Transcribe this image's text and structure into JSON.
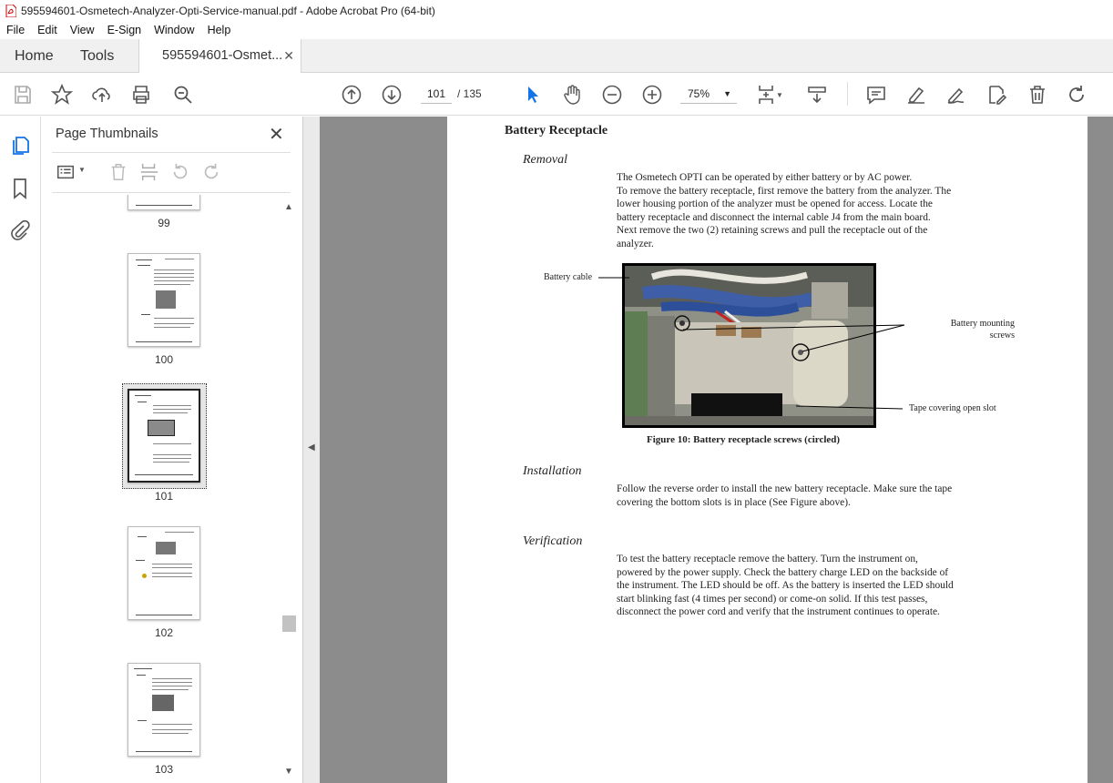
{
  "window": {
    "title": "595594601-Osmetech-Analyzer-Opti-Service-manual.pdf - Adobe Acrobat Pro (64-bit)"
  },
  "menu": [
    "File",
    "Edit",
    "View",
    "E-Sign",
    "Window",
    "Help"
  ],
  "tabs": {
    "home": "Home",
    "tools": "Tools",
    "doc": "595594601-Osmet...",
    "close": "✕"
  },
  "toolbar": {
    "page_current": "101",
    "page_total": "/ 135",
    "zoom": "75%"
  },
  "panel": {
    "title": "Page Thumbnails",
    "close": "✕"
  },
  "thumbnails": [
    {
      "label": "99"
    },
    {
      "label": "100"
    },
    {
      "label": "101",
      "selected": true
    },
    {
      "label": "102"
    },
    {
      "label": "103"
    }
  ],
  "doc": {
    "heading": "Battery Receptacle",
    "removal_title": "Removal",
    "removal_lines": [
      "The Osmetech OPTI can be operated by either battery or by AC power.",
      "To remove the battery receptacle, first remove the battery from the analyzer.  The",
      "lower housing portion of the analyzer must be opened for access.  Locate the",
      "battery receptacle and disconnect the internal cable J4 from the main board.",
      "Next remove the two (2) retaining screws and pull the receptacle out of the",
      "analyzer."
    ],
    "figure": {
      "label_cable": "Battery cable",
      "label_screws_1": "Battery mounting",
      "label_screws_2": "screws",
      "label_tape": "Tape covering open slot",
      "caption": "Figure 10: Battery receptacle screws (circled)"
    },
    "installation_title": "Installation",
    "installation_lines": [
      "Follow the reverse order to install the new battery receptacle. Make sure the tape",
      "covering the bottom slots is in place (See Figure above)."
    ],
    "verification_title": "Verification",
    "verification_lines": [
      "To test the battery receptacle remove the battery. Turn the instrument on,",
      "powered by the power supply. Check the battery charge LED on the backside of",
      "the instrument. The LED should be off. As the battery is inserted the LED should",
      "start blinking fast (4 times per second) or come-on solid. If this test passes,",
      "disconnect the power cord and verify that the instrument continues to operate."
    ]
  },
  "icons": [
    "pdf-file-icon",
    "save-icon",
    "bookmark-star-icon",
    "upload-icon",
    "print-icon",
    "search-zoom-icon",
    "prev-page-icon",
    "next-page-icon",
    "select-cursor-icon",
    "hand-icon",
    "zoom-out-icon",
    "zoom-in-icon",
    "page-fit-icon",
    "scroll-mode-icon",
    "comment-icon",
    "highlight-icon",
    "sign-icon",
    "edit-icon",
    "delete-icon",
    "rotate-icon",
    "pages-panel-icon",
    "bookmarks-icon",
    "attachments-icon"
  ]
}
